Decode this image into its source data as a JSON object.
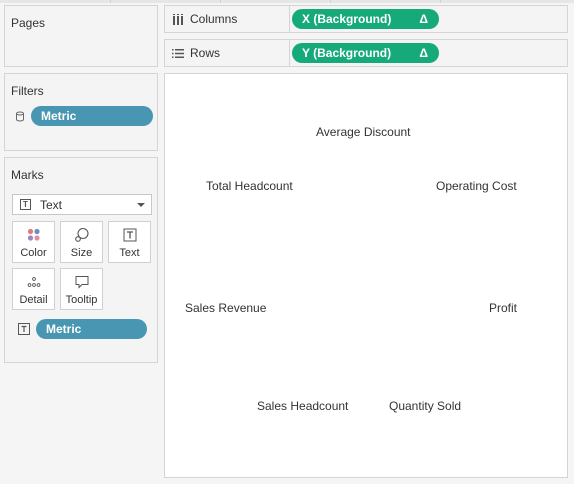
{
  "pages": {
    "title": "Pages"
  },
  "filters": {
    "title": "Filters",
    "pills": [
      {
        "label": "Metric",
        "icon": "database-icon"
      }
    ]
  },
  "marks": {
    "title": "Marks",
    "mark_type": {
      "label": "Text",
      "icon": "text-icon"
    },
    "buttons": [
      {
        "label": "Color",
        "icon": "color-dots-icon"
      },
      {
        "label": "Size",
        "icon": "size-icon"
      },
      {
        "label": "Text",
        "icon": "text-icon"
      },
      {
        "label": "Detail",
        "icon": "detail-dots-icon"
      },
      {
        "label": "Tooltip",
        "icon": "tooltip-icon"
      }
    ],
    "fields": [
      {
        "label": "Metric",
        "icon": "text-icon"
      }
    ]
  },
  "shelves": {
    "columns": {
      "label": "Columns",
      "icon": "columns-icon",
      "pill": {
        "label": "X (Background)",
        "suffix": "Δ"
      }
    },
    "rows": {
      "label": "Rows",
      "icon": "rows-icon",
      "pill": {
        "label": "Y (Background)",
        "suffix": "Δ"
      }
    }
  },
  "canvas": {
    "labels": [
      "Average Discount",
      "Total Headcount",
      "Operating Cost",
      "Sales Revenue",
      "Profit",
      "Sales Headcount",
      "Quantity Sold"
    ]
  },
  "colors": {
    "pill_blue": "#4996b2",
    "pill_green": "#16a97a",
    "panel_bg": "#f4f4f4",
    "border": "#d4d4d4"
  }
}
